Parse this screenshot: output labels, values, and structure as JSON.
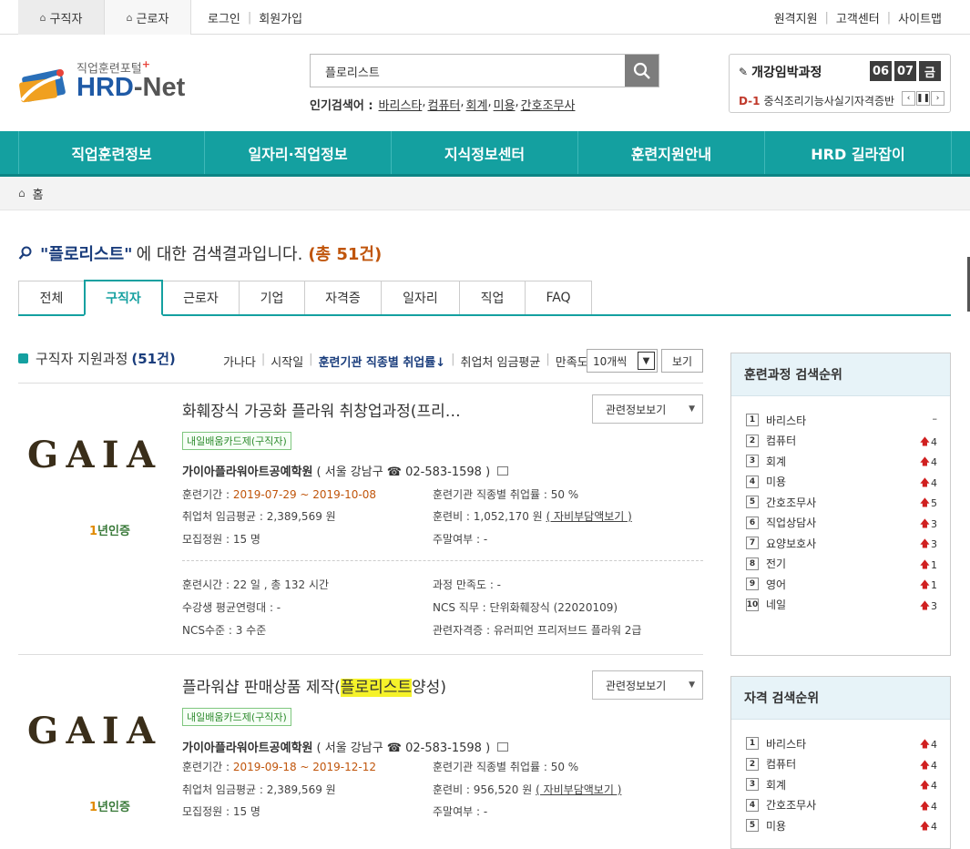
{
  "topbar": {
    "tab_jobseeker": "구직자",
    "tab_worker": "근로자",
    "login": "로그인",
    "signup": "회원가입",
    "remote": "원격지원",
    "center": "고객센터",
    "sitemap": "사이트맵"
  },
  "logo": {
    "sub": "직업훈련포털",
    "plus": "+",
    "name_a": "HRD",
    "name_b": "-Net"
  },
  "search": {
    "value": "플로리스트",
    "popular_label": "인기검색어 :",
    "popular": [
      "바리스타",
      "컴퓨터",
      "회계",
      "미용",
      "간호조무사"
    ]
  },
  "openbox": {
    "title": "개강임박과정",
    "month": "06",
    "day": "07",
    "weekday": "금",
    "dday": "D-1",
    "course": "중식조리기능사실기자격증반"
  },
  "nav": [
    "직업훈련정보",
    "일자리·직업정보",
    "지식정보센터",
    "훈련지원안내",
    "HRD 길라잡이"
  ],
  "breadcrumb": {
    "home": "홈"
  },
  "result": {
    "keyword": "\"플로리스트\"",
    "middle": "에 대한 검색결과입니다.",
    "count": "(총 51건)"
  },
  "tabs": [
    "전체",
    "구직자",
    "근로자",
    "기업",
    "자격증",
    "일자리",
    "직업",
    "FAQ"
  ],
  "section": {
    "title": "구직자 지원과정",
    "count": "(51건)",
    "sorts": [
      "가나다",
      "시작일",
      "훈련기관 직종별 취업률↓",
      "취업처 임금평균",
      "만족도"
    ],
    "per_page": "10개씩",
    "view": "보기"
  },
  "courses": [
    {
      "logo": "GAIA",
      "cert": "년인증",
      "cert_num": "1",
      "title": "화훼장식 가공화 플라워 취창업과정(프리…",
      "title_hl": "",
      "title_post": "",
      "badge": "내일배움카드제(구직자)",
      "related": "관련정보보기",
      "inst": "가이아플라워아트공예학원",
      "inst_loc": "( 서울 강남구 ☎ 02-583-1598 )",
      "period_label": "훈련기간 : ",
      "period": "2019-07-29 ~ 2019-10-08",
      "emp_label": "훈련기관 직종별 취업률 : ",
      "emp": "50 %",
      "wage": "취업처 임금평균 : 2,389,569 원",
      "fee_label": "훈련비 : 1,052,170 원",
      "fee_link": "( 자비부담액보기 )",
      "recruit": "모집정원 : 15 명",
      "weekend": "주말여부 : -",
      "hours": "훈련시간 : 22 일 , 총 132 시간",
      "satisfaction": "과정 만족도 : -",
      "age": "수강생 평균연령대 : -",
      "ncs_job": "NCS 직무 : 단위화훼장식 (22020109)",
      "ncs_level": "NCS수준 : 3 수준",
      "license": "관련자격증 : 유러피언 프리저브드 플라워 2급"
    },
    {
      "logo": "GAIA",
      "cert": "년인증",
      "cert_num": "1",
      "title": "플라워샵 판매상품 제작(",
      "title_hl": "플로리스트",
      "title_post": "양성)",
      "badge": "내일배움카드제(구직자)",
      "related": "관련정보보기",
      "inst": "가이아플라워아트공예학원",
      "inst_loc": "( 서울 강남구 ☎ 02-583-1598 )",
      "period_label": "훈련기간 : ",
      "period": "2019-09-18 ~ 2019-12-12",
      "emp_label": "훈련기관 직종별 취업률 : ",
      "emp": "50 %",
      "wage": "취업처 임금평균 : 2,389,569 원",
      "fee_label": "훈련비 : 956,520 원",
      "fee_link": "( 자비부담액보기 )",
      "recruit": "모집정원 : 15 명",
      "weekend": "주말여부 : -"
    }
  ],
  "rank_course": {
    "title": "훈련과정 검색순위",
    "items": [
      {
        "n": "1",
        "name": "바리스타",
        "ch": "–",
        "up": false
      },
      {
        "n": "2",
        "name": "컴퓨터",
        "ch": "4",
        "up": true
      },
      {
        "n": "3",
        "name": "회계",
        "ch": "4",
        "up": true
      },
      {
        "n": "4",
        "name": "미용",
        "ch": "4",
        "up": true
      },
      {
        "n": "5",
        "name": "간호조무사",
        "ch": "5",
        "up": true
      },
      {
        "n": "6",
        "name": "직업상담사",
        "ch": "3",
        "up": true
      },
      {
        "n": "7",
        "name": "요양보호사",
        "ch": "3",
        "up": true
      },
      {
        "n": "8",
        "name": "전기",
        "ch": "1",
        "up": true
      },
      {
        "n": "9",
        "name": "영어",
        "ch": "1",
        "up": true
      },
      {
        "n": "10",
        "name": "네일",
        "ch": "3",
        "up": true
      }
    ]
  },
  "rank_license": {
    "title": "자격 검색순위",
    "items": [
      {
        "n": "1",
        "name": "바리스타",
        "ch": "4",
        "up": true
      },
      {
        "n": "2",
        "name": "컴퓨터",
        "ch": "4",
        "up": true
      },
      {
        "n": "3",
        "name": "회계",
        "ch": "4",
        "up": true
      },
      {
        "n": "4",
        "name": "간호조무사",
        "ch": "4",
        "up": true
      },
      {
        "n": "5",
        "name": "미용",
        "ch": "4",
        "up": true
      }
    ]
  },
  "colors": {
    "teal": "#14a0a0",
    "navy": "#1a3d7c",
    "orange": "#c0550b",
    "red": "#d02020"
  }
}
